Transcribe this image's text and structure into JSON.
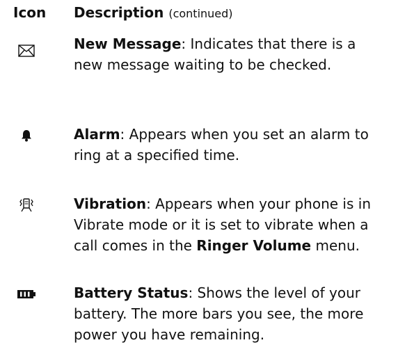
{
  "header": {
    "icon_label": "Icon",
    "desc_label": "Description",
    "desc_suffix": "(continued)"
  },
  "rows": [
    {
      "icon": "envelope-icon",
      "title": "New Message",
      "text": ": Indicates that there is a new message waiting to be checked."
    },
    {
      "icon": "bell-icon",
      "title": "Alarm",
      "text": ": Appears when you set an alarm to ring at a specified time."
    },
    {
      "icon": "vibration-icon",
      "title": "Vibration",
      "text_a": ": Appears when your phone is in Vibrate mode or it is set to vibrate when a call comes in the ",
      "bold_b": "Ringer Volume",
      "text_c": " menu."
    },
    {
      "icon": "battery-icon",
      "title": "Battery Status",
      "text": ": Shows the level of your battery. The more bars you see, the more power you have remaining."
    }
  ]
}
